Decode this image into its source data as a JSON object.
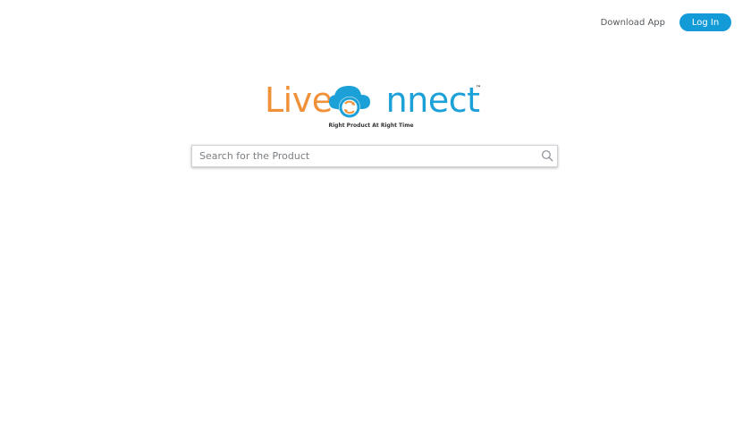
{
  "header": {
    "download_label": "Download App",
    "login_label": "Log In"
  },
  "logo": {
    "part_live": "Live",
    "part_c": "C",
    "part_nnect": "nnect",
    "trademark": "™",
    "tagline": "Right Product At Right Time",
    "colors": {
      "orange": "#f0913a",
      "blue": "#1ca0d8"
    }
  },
  "search": {
    "placeholder": "Search for the Product",
    "value": "",
    "icon": "search-icon"
  },
  "colors": {
    "accent": "#139bd8"
  }
}
